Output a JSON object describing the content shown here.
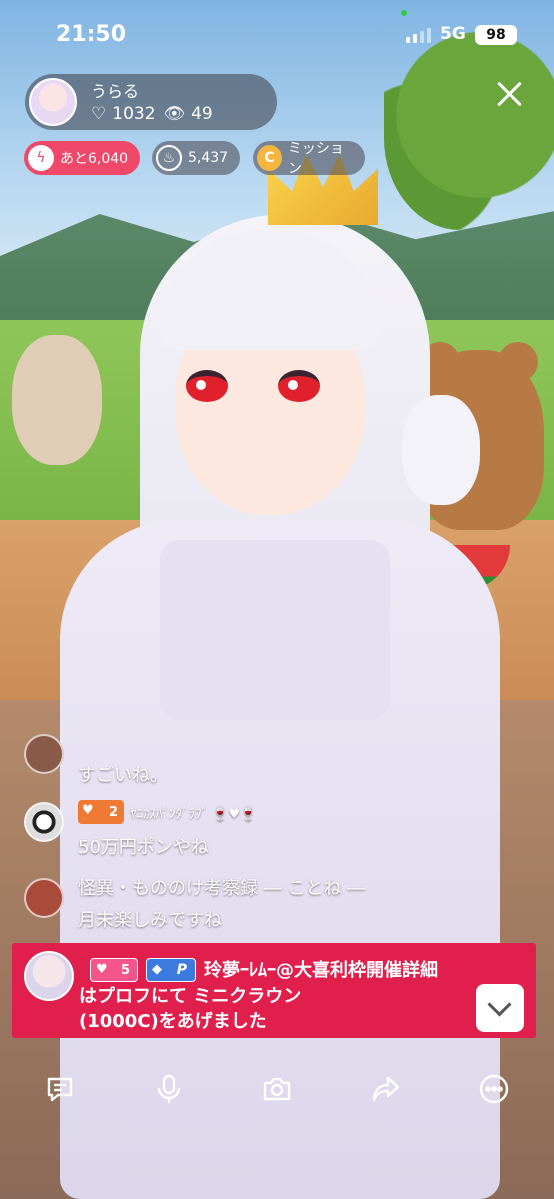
{
  "status_bar": {
    "time": "21:50",
    "network": "5G",
    "battery": "98"
  },
  "streamer": {
    "name": "うらる",
    "likes_icon": "heart-outline-icon",
    "likes": "1032",
    "viewers_icon": "eye-icon",
    "viewers": "49"
  },
  "pills": {
    "goal": {
      "icon": "lightning-icon",
      "label": "あと6,040"
    },
    "fire": {
      "icon": "flame-icon",
      "label": "5,437"
    },
    "mission": {
      "icon": "coin-icon",
      "icon_letter": "C",
      "label": "ミッション"
    }
  },
  "chat": [
    {
      "text": "すごいね。"
    },
    {
      "badge_level": "2",
      "name": "ﾔﾆｶｽﾊﾟﾝﾀﾞﾗﾌﾞ 🍷♥🍷",
      "text": "50万円ポンやね"
    },
    {
      "text": "怪異・もののけ考察録 ― ことね ―"
    },
    {
      "text": "月末楽しみですね"
    }
  ],
  "gift": {
    "level": "5",
    "p_label": "P",
    "line1": "玲夢ｰﾚﾑｰ@大喜利枠開催詳細",
    "line2": "はプロフにて ミニクラウン",
    "line3": "(1000C)をあげました"
  },
  "toolbar": {
    "comment": "comment-icon",
    "mic": "microphone-icon",
    "camera": "camera-icon",
    "share": "share-icon",
    "more": "more-icon"
  },
  "colors": {
    "accent": "#e11f4d",
    "goal_pill": "#f04868",
    "mission_coin": "#f5b640",
    "level_badge": "#ef7a33",
    "premium": "#3c7ae0"
  }
}
